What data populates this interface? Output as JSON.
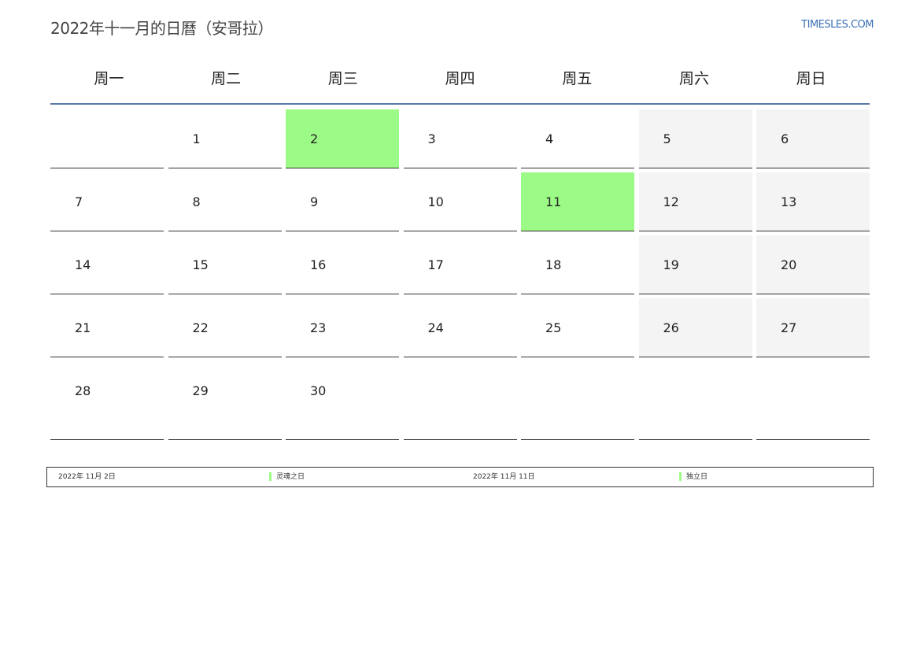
{
  "header": {
    "title": "2022年十一月的日曆（安哥拉）",
    "brand": "TIMESLES.COM"
  },
  "weekdays": [
    "周一",
    "周二",
    "周三",
    "周四",
    "周五",
    "周六",
    "周日"
  ],
  "weeks": [
    [
      "",
      "1",
      "2",
      "3",
      "4",
      "5",
      "6"
    ],
    [
      "7",
      "8",
      "9",
      "10",
      "11",
      "12",
      "13"
    ],
    [
      "14",
      "15",
      "16",
      "17",
      "18",
      "19",
      "20"
    ],
    [
      "21",
      "22",
      "23",
      "24",
      "25",
      "26",
      "27"
    ],
    [
      "28",
      "29",
      "30",
      "",
      "",
      "",
      ""
    ]
  ],
  "holiday_days": [
    "2",
    "11"
  ],
  "colors": {
    "holiday": "#9cfb86",
    "weekend": "#f4f4f4",
    "header_rule": "#5a7aa8",
    "brand": "#3b6fb6"
  },
  "legend": [
    {
      "date": "2022年 11月 2日",
      "name": "灵魂之日"
    },
    {
      "date": "2022年 11月 11日",
      "name": "独立日"
    }
  ]
}
